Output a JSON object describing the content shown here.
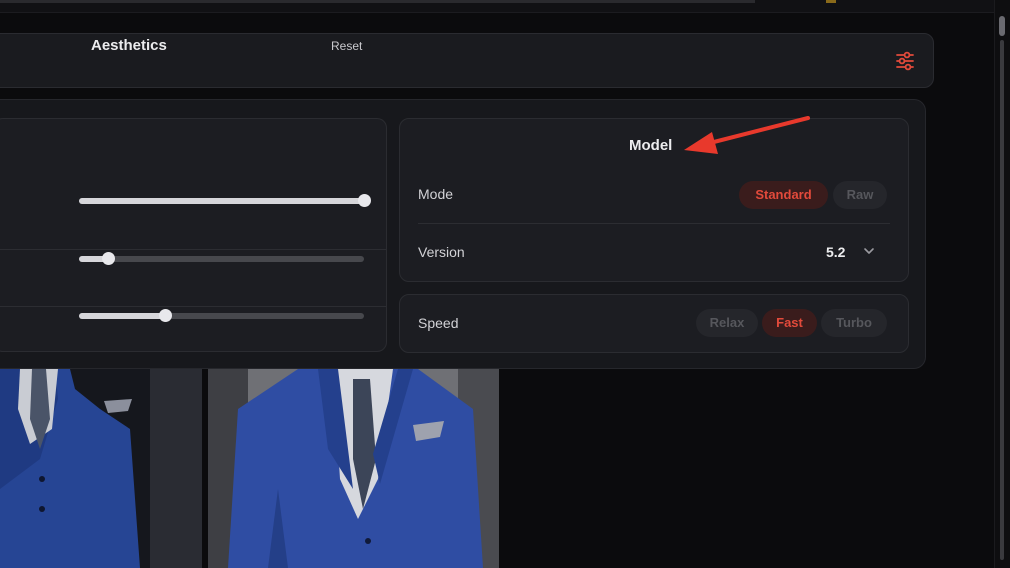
{
  "aesthetics": {
    "title": "Aesthetics",
    "reset_label": "Reset",
    "sliders": [
      {
        "value": 100
      },
      {
        "value": 10
      },
      {
        "value": 30
      }
    ]
  },
  "model": {
    "title": "Model",
    "mode_label": "Mode",
    "mode_options": [
      "Standard",
      "Raw"
    ],
    "mode_selected": "Standard",
    "version_label": "Version",
    "version_value": "5.2"
  },
  "speed": {
    "label": "Speed",
    "options": [
      "Relax",
      "Fast",
      "Turbo"
    ],
    "selected": "Fast"
  },
  "colors": {
    "accent": "#e24a3b",
    "annotation_arrow": "#e8392c",
    "suit_blue": "#2d4b9a"
  },
  "icons": {
    "settings": "sliders-icon",
    "version_dropdown": "chevron-down-icon"
  }
}
